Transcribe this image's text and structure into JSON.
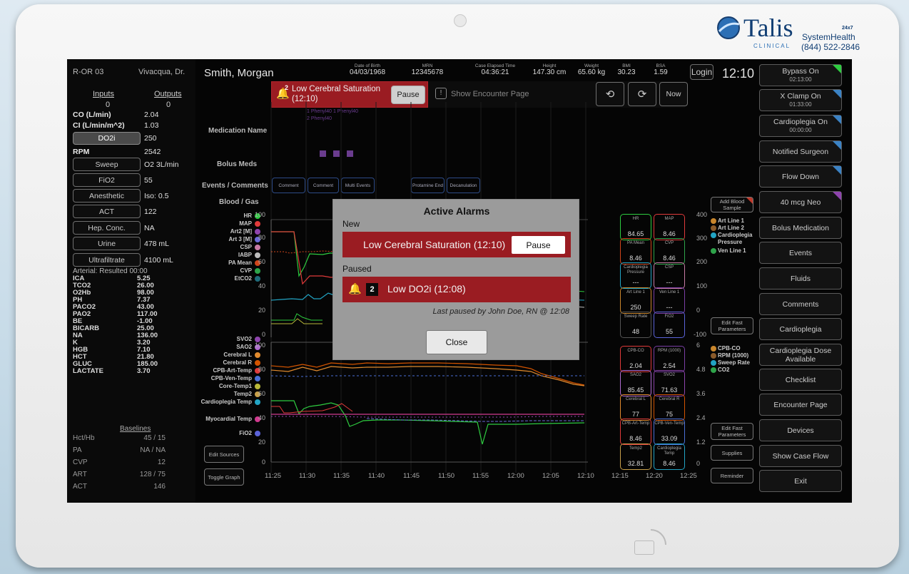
{
  "brand": {
    "name": "Talis",
    "sub": "CLINICAL",
    "tag": "24x7",
    "line": "SystemHealth",
    "phone": "(844) 522-2846"
  },
  "room": "R-OR 03",
  "doctor": "Vivacqua, Dr.",
  "patient": "Smith, Morgan",
  "header": [
    {
      "label": "Date of Birth",
      "value": "04/03/1968"
    },
    {
      "label": "MRN",
      "value": "12345678"
    },
    {
      "label": "Case Elapsed Time",
      "value": "04:36:21"
    },
    {
      "label": "Height",
      "value": "147.30 cm"
    },
    {
      "label": "Weight",
      "value": "65.60 kg"
    },
    {
      "label": "BMI",
      "value": "30.23"
    },
    {
      "label": "BSA",
      "value": "1.59"
    }
  ],
  "login": "Login",
  "clock": "12:10",
  "io": {
    "inputs": "Inputs",
    "outputs": "Outputs",
    "in_val": "0",
    "out_val": "0"
  },
  "flows": [
    {
      "label": "CO (L/min)",
      "value": "2.04"
    },
    {
      "label": "CI (L/min/m^2)",
      "value": "1.03"
    }
  ],
  "do2i": {
    "label": "DO2i",
    "value": "250"
  },
  "rpm": {
    "label": "RPM",
    "value": "2542"
  },
  "params": [
    {
      "label": "Sweep",
      "value": "O2 3L/min"
    },
    {
      "label": "FiO2",
      "value": "55"
    },
    {
      "label": "Anesthetic",
      "value": "Iso: 0.5"
    },
    {
      "label": "ACT",
      "value": "122"
    },
    {
      "label": "Hep. Conc.",
      "value": "NA"
    },
    {
      "label": "Urine",
      "value": "478 mL"
    },
    {
      "label": "Ultrafiltrate",
      "value": "4100 mL"
    }
  ],
  "arterial_title": "Arterial: Resulted 00:00",
  "labs": [
    {
      "k": "ICA",
      "v": "5.25"
    },
    {
      "k": "TCO2",
      "v": "26.00"
    },
    {
      "k": "O2Hb",
      "v": "98.00"
    },
    {
      "k": "PH",
      "v": "7.37"
    },
    {
      "k": "PACO2",
      "v": "43.00"
    },
    {
      "k": "PAO2",
      "v": "117.00"
    },
    {
      "k": "BE",
      "v": "-1.00"
    },
    {
      "k": "BICARB",
      "v": "25.00"
    },
    {
      "k": "NA",
      "v": "136.00"
    },
    {
      "k": "K",
      "v": "3.20"
    },
    {
      "k": "HGB",
      "v": "7.10"
    },
    {
      "k": "HCT",
      "v": "21.80"
    },
    {
      "k": "GLUC",
      "v": "185.00"
    },
    {
      "k": "LACTATE",
      "v": "3.70"
    }
  ],
  "baselines_title": "Baselines",
  "baselines": [
    {
      "k": "Hct/Hb",
      "v": "45 / 15"
    },
    {
      "k": "PA",
      "v": "NA / NA"
    },
    {
      "k": "CVP",
      "v": "12"
    },
    {
      "k": "ART",
      "v": "128 / 75"
    },
    {
      "k": "ACT",
      "v": "146"
    }
  ],
  "alarm_bar": {
    "count": "2",
    "text1": "Low Cerebral Saturation",
    "text2": "(12:10)",
    "pause": "Pause",
    "encounter": "Show Encounter Page",
    "now": "Now"
  },
  "sections": {
    "med": "Medication Name",
    "bolus": "Bolus Meds",
    "events": "Events / Comments",
    "blood": "Blood / Gas"
  },
  "med_entries": [
    "1 Phenyl40  1 Phenyl40",
    "2 Phenyl40"
  ],
  "events": [
    "Comment",
    "Comment",
    "Multi Events",
    "Protamine End",
    "Decanulation"
  ],
  "vitals_top": [
    "HR",
    "MAP",
    "Art2 [M]",
    "Art 3 [M]",
    "CSP",
    "IABP",
    "PA Mean",
    "CVP",
    "EtCO2"
  ],
  "vitals_bottom": [
    "SVO2",
    "SAO2",
    "Cerebral L",
    "Cerebral R",
    "CPB-Art-Temp",
    "CPB-Ven-Temp",
    "Core-Temp1",
    "Temp2",
    "Cardioplegia Temp",
    "Myocardial Temp",
    "FiO2"
  ],
  "colors": {
    "alarm_red": "#9a1c22",
    "hr": "#2ecc40",
    "map": "#e03a3a",
    "art2": "#8e44ad",
    "art3": "#6b6ad8",
    "csp": "#c77ba5",
    "iabp": "#bdbdbd",
    "pamean": "#d0451b",
    "cvp": "#2ea34a",
    "etco2": "#1e6b7a"
  },
  "axis_top": [
    "100",
    "80",
    "60",
    "40",
    "20",
    "0"
  ],
  "axis_bot": [
    "100",
    "80",
    "60",
    "40",
    "20",
    "0"
  ],
  "time_ticks": [
    "11:25",
    "11:30",
    "11:35",
    "11:40",
    "11:45",
    "11:50",
    "11:55",
    "12:00",
    "12:05",
    "12:10",
    "12:15",
    "12:20",
    "12:25"
  ],
  "tiles_top": [
    {
      "l": "HR",
      "v": "84.65"
    },
    {
      "l": "MAP",
      "v": "8.46"
    },
    {
      "l": "PA Mean",
      "v": "8.46"
    },
    {
      "l": "CVP",
      "v": "8.46"
    },
    {
      "l": "Cardioplegia Pressure",
      "v": "---"
    },
    {
      "l": "CSP",
      "v": "---"
    },
    {
      "l": "Art Line 1",
      "v": "250"
    },
    {
      "l": "Ven Line 1",
      "v": "---"
    },
    {
      "l": "Sweep Rate",
      "v": "48"
    },
    {
      "l": "FiO2",
      "v": "55"
    }
  ],
  "tiles_bot": [
    {
      "l": "CPB-CO",
      "v": "2.04"
    },
    {
      "l": "RPM (1000)",
      "v": "2.54"
    },
    {
      "l": "SAO2",
      "v": "85.45"
    },
    {
      "l": "SVO2",
      "v": "71.63"
    },
    {
      "l": "Cerebral L",
      "v": "77"
    },
    {
      "l": "Cerebral R",
      "v": "75"
    },
    {
      "l": "CPB-Art-Temp",
      "v": "8.46"
    },
    {
      "l": "CPB-Ven-Temp",
      "v": "33.09"
    },
    {
      "l": "Temp2",
      "v": "32.81"
    },
    {
      "l": "Cardioplegia Temp",
      "v": "8.46"
    }
  ],
  "raxis_top": [
    "400",
    "300",
    "200",
    "100",
    "0",
    "-100"
  ],
  "raxis_bot": [
    "6",
    "4.8",
    "3.6",
    "2.4",
    "1.2",
    "0"
  ],
  "legend_top": [
    "Art Line 1",
    "Art Line 2",
    "Cardioplegia Pressure",
    "Ven Line 1"
  ],
  "legend_bot": [
    "CPB-CO",
    "RPM (1000)",
    "Sweep Rate",
    "CO2"
  ],
  "small_buttons": {
    "add_blood": "Add Blood Sample",
    "edit_fast1": "Edit Fast Parameters",
    "edit_fast2": "Edit Fast Parameters",
    "supplies": "Supplies",
    "reminder": "Reminder",
    "edit_sources": "Edit Sources",
    "toggle_graph": "Toggle Graph"
  },
  "right_buttons": [
    {
      "label": "Bypass On",
      "sub": "02:13:00"
    },
    {
      "label": "X Clamp On",
      "sub": "01:33:00"
    },
    {
      "label": "Cardioplegia On",
      "sub": "00:00:00"
    },
    {
      "label": "Notified Surgeon",
      "sub": ""
    },
    {
      "label": "Flow Down",
      "sub": ""
    },
    {
      "label": "40 mcg Neo",
      "sub": ""
    },
    {
      "label": "Bolus Medication",
      "sub": ""
    },
    {
      "label": "Events",
      "sub": ""
    },
    {
      "label": "Fluids",
      "sub": ""
    },
    {
      "label": "Comments",
      "sub": ""
    },
    {
      "label": "Cardioplegia",
      "sub": ""
    },
    {
      "label": "Cardioplegia Dose Available",
      "sub": ""
    },
    {
      "label": "Checklist",
      "sub": ""
    },
    {
      "label": "Encounter Page",
      "sub": ""
    },
    {
      "label": "Devices",
      "sub": ""
    },
    {
      "label": "Show Case Flow",
      "sub": ""
    },
    {
      "label": "Exit",
      "sub": ""
    }
  ],
  "modal": {
    "title": "Active Alarms",
    "new": "New",
    "new_alarm": "Low Cerebral Saturation (12:10)",
    "pause": "Pause",
    "paused": "Paused",
    "paused_count": "2",
    "paused_alarm": "Low DO2i (12:08)",
    "note": "Last paused by John Doe, RN @ 12:08",
    "close": "Close"
  }
}
